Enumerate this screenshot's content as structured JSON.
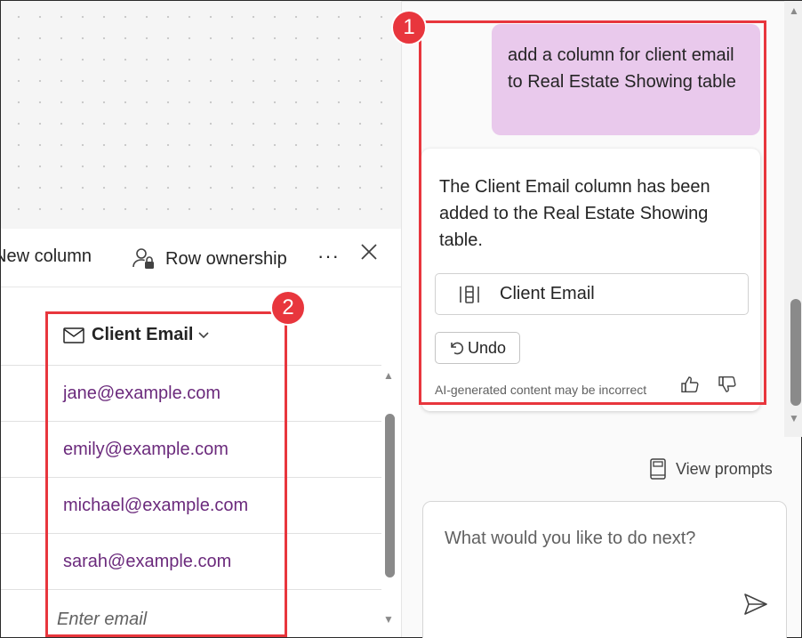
{
  "toolbar": {
    "new_column_label": "New column",
    "row_ownership_label": "Row ownership",
    "more_label": "···",
    "close_label": "Close"
  },
  "table": {
    "column_header": "Client Email",
    "rows": [
      "jane@example.com",
      "emily@example.com",
      "michael@example.com",
      "sarah@example.com"
    ],
    "new_row_placeholder": "Enter email"
  },
  "chat": {
    "user_message": "add a column for client email to Real Estate Showing table",
    "ai_response": "The Client Email column has been added to the Real Estate Showing table.",
    "citation_label": "Client Email",
    "undo_label": "Undo",
    "ai_disclaimer": "AI-generated content may be incorrect",
    "view_prompts_label": "View prompts",
    "input_placeholder": "What would you like to do next?"
  },
  "annotations": {
    "badge_1": "1",
    "badge_2": "2"
  },
  "colors": {
    "user_bubble": "#e9c9ec",
    "email_text": "#6b2a7c",
    "highlight": "#e8363d"
  },
  "icons": [
    "row-ownership-icon",
    "close-icon",
    "mail-icon",
    "chevron-down-icon",
    "column-icon",
    "undo-icon",
    "thumbs-up-icon",
    "thumbs-down-icon",
    "book-icon",
    "send-icon"
  ]
}
